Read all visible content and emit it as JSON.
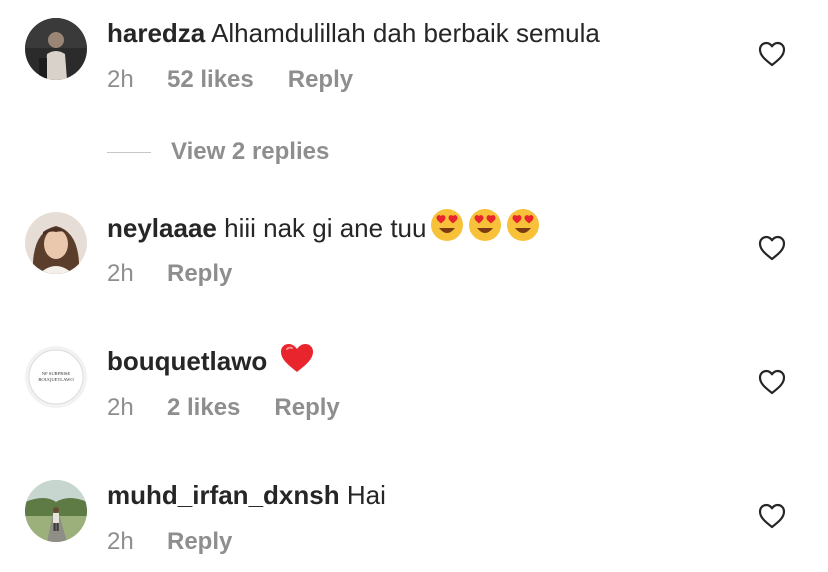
{
  "comments": [
    {
      "username": "haredza",
      "text": "Alhamdulillah dah berbaik semula",
      "time": "2h",
      "likes": "52 likes",
      "reply": "Reply"
    },
    {
      "username": "neylaaae",
      "text": "hiii nak gi ane tuu",
      "time": "2h",
      "reply": "Reply",
      "emojis": [
        "heart-eyes-emoji",
        "heart-eyes-emoji",
        "heart-eyes-emoji"
      ]
    },
    {
      "username": "bouquetlawo",
      "text": "",
      "time": "2h",
      "likes": "2 likes",
      "reply": "Reply",
      "emojis": [
        "red-heart-emoji"
      ],
      "avatar_text": [
        "NF SURPRISE",
        "BOUQUETLAWO"
      ]
    },
    {
      "username": "muhd_irfan_dxnsh",
      "text": "Hai",
      "time": "2h",
      "reply": "Reply"
    }
  ],
  "view_replies": "View 2 replies",
  "icons": {
    "like": "heart-outline-icon"
  },
  "colors": {
    "text": "#262626",
    "secondary": "#8e8e8e",
    "divider": "#c7c7c7"
  }
}
